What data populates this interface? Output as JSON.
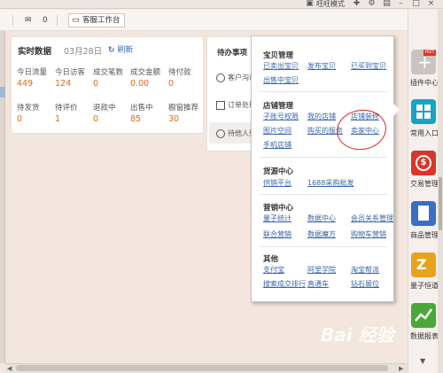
{
  "titlebar": {
    "mode_label": "旺旺模式"
  },
  "toolbar": {
    "mail_count": "0",
    "workbench_label": "客服工作台"
  },
  "stats": {
    "title": "实时数据",
    "date": "03月28日",
    "refresh": "刷新",
    "row1": [
      {
        "label": "今日流量",
        "value": "449"
      },
      {
        "label": "今日访客",
        "value": "124"
      },
      {
        "label": "成交笔数",
        "value": "0"
      },
      {
        "label": "成交金额",
        "value": "0.00"
      },
      {
        "label": "待付款",
        "value": "0"
      }
    ],
    "row2": [
      {
        "label": "待发货",
        "value": "0"
      },
      {
        "label": "待评价",
        "value": "1"
      },
      {
        "label": "退款中",
        "value": "0"
      },
      {
        "label": "出售中",
        "value": "85"
      },
      {
        "label": "橱窗推荐",
        "value": "30"
      }
    ]
  },
  "todo": {
    "title": "待办事项",
    "items": [
      "客户沟通",
      "订单处理",
      "待他人处"
    ]
  },
  "menu": {
    "sections": [
      {
        "title": "宝贝管理",
        "links": [
          "已卖出宝贝",
          "发布宝贝",
          "已买到宝贝",
          "出售中宝贝"
        ]
      },
      {
        "title": "店铺管理",
        "links": [
          "子账号权限",
          "我的店铺",
          "店铺装修",
          "图片空间",
          "购买的服务",
          "卖家中心",
          "手机店铺"
        ]
      },
      {
        "title": "货源中心",
        "links": [
          "供销平台",
          "1688采购批发"
        ]
      },
      {
        "title": "营销中心",
        "links": [
          "量子统计",
          "数据中心",
          "会员关系管理",
          "联合营销",
          "数据魔方",
          "购物车营销"
        ]
      },
      {
        "title": "其他",
        "links": [
          "支付宝",
          "阿里学院",
          "淘宝帮派",
          "搜索成交排行",
          "直通车",
          "钻石展位"
        ]
      }
    ]
  },
  "sidebar": {
    "items": [
      {
        "label": "插件中心",
        "color": "#c9c4c0",
        "badge": "HOT",
        "icon": "plus-icon"
      },
      {
        "label": "常用入口",
        "color": "#17a3c4",
        "icon": "grid-icon"
      },
      {
        "label": "交易管理",
        "color": "#d9362b",
        "icon": "money-icon"
      },
      {
        "label": "商品管理",
        "color": "#3a6fc4",
        "icon": "goods-icon"
      },
      {
        "label": "量子恒道",
        "color": "#e9a21d",
        "icon": "quantum-icon"
      },
      {
        "label": "数据报表",
        "color": "#4aa83a",
        "icon": "chart-icon"
      }
    ]
  },
  "watermark": "Bai 经验"
}
